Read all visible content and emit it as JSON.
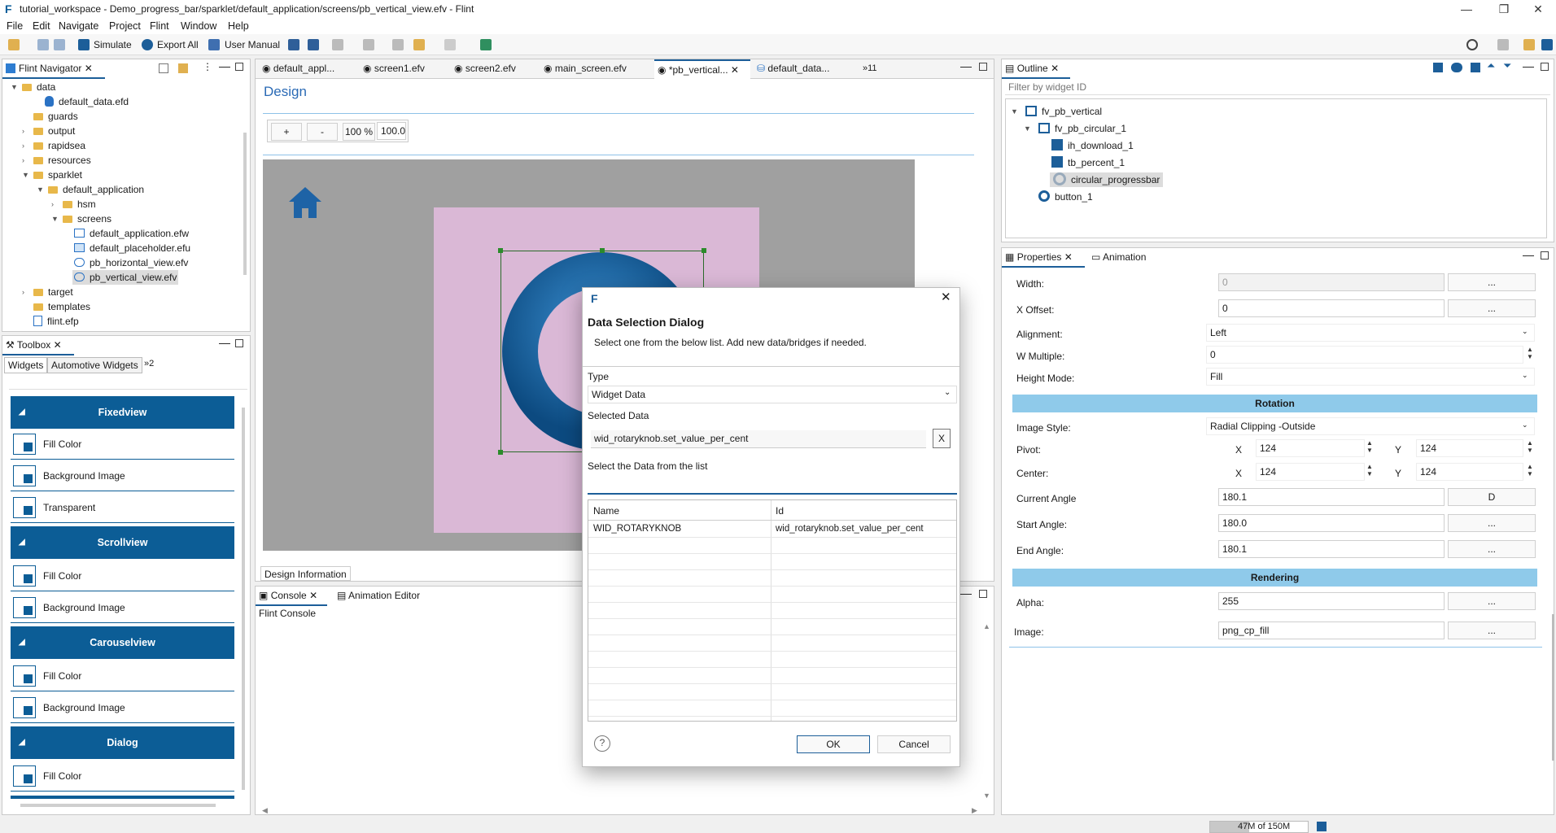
{
  "window": {
    "title": "tutorial_workspace - Demo_progress_bar/sparklet/default_application/screens/pb_vertical_view.efv - Flint",
    "minimize": "—",
    "restore": "❐",
    "close": "✕"
  },
  "menu": [
    "File",
    "Edit",
    "Navigate",
    "Project",
    "Flint",
    "Window",
    "Help"
  ],
  "toolbar": {
    "simulate": "Simulate",
    "export_all": "Export All",
    "user_manual": "User Manual"
  },
  "navigator": {
    "title": "Flint Navigator",
    "items": [
      {
        "label": "data",
        "type": "folder",
        "expanded": true
      },
      {
        "label": "default_data.efd",
        "type": "file"
      },
      {
        "label": "guards",
        "type": "folder"
      },
      {
        "label": "output",
        "type": "folder"
      },
      {
        "label": "rapidsea",
        "type": "folder"
      },
      {
        "label": "resources",
        "type": "folder"
      },
      {
        "label": "sparklet",
        "type": "folder",
        "expanded": true
      },
      {
        "label": "default_application",
        "type": "folder",
        "expanded": true
      },
      {
        "label": "hsm",
        "type": "folder"
      },
      {
        "label": "screens",
        "type": "folder",
        "expanded": true
      },
      {
        "label": "default_application.efw",
        "type": "file"
      },
      {
        "label": "default_placeholder.efu",
        "type": "file"
      },
      {
        "label": "pb_horizontal_view.efv",
        "type": "file"
      },
      {
        "label": "pb_vertical_view.efv",
        "type": "file",
        "selected": true
      },
      {
        "label": "target",
        "type": "folder"
      },
      {
        "label": "templates",
        "type": "folder"
      },
      {
        "label": "flint.efp",
        "type": "file"
      }
    ]
  },
  "toolbox": {
    "title": "Toolbox",
    "tabs": [
      "Widgets",
      "Automotive Widgets",
      "»2"
    ],
    "sections": [
      {
        "head": "Fixedview",
        "items": [
          "Fill Color",
          "Background Image",
          "Transparent"
        ]
      },
      {
        "head": "Scrollview",
        "items": [
          "Fill Color",
          "Background Image"
        ]
      },
      {
        "head": "Carouselview",
        "items": [
          "Fill Color",
          "Background Image"
        ]
      },
      {
        "head": "Dialog",
        "items": [
          "Fill Color"
        ]
      }
    ]
  },
  "editor_tabs": [
    "default_appl...",
    "screen1.efv",
    "screen2.efv",
    "main_screen.efv",
    "*pb_vertical...",
    "default_data...",
    "»11"
  ],
  "design": {
    "title": "Design",
    "zoom_in": "+",
    "zoom_out": "-",
    "zoom_pct": "100 %",
    "zoom_value": "100.0",
    "info_tab": "Design Information"
  },
  "console": {
    "tab": "Console",
    "anim_tab": "Animation Editor",
    "label": "Flint Console"
  },
  "outline": {
    "title": "Outline",
    "filter_placeholder": "Filter by widget ID",
    "items": [
      "fv_pb_vertical",
      "fv_pb_circular_1",
      "ih_download_1",
      "tb_percent_1",
      "circular_progressbar",
      "button_1"
    ]
  },
  "properties": {
    "tab": "Properties",
    "anim_tab": "Animation",
    "width_label": "Width:",
    "width_value": "0",
    "xoffset_label": "X Offset:",
    "xoffset_value": "0",
    "alignment_label": "Alignment:",
    "alignment_value": "Left",
    "wmult_label": "W Multiple:",
    "wmult_value": "0",
    "height_mode_label": "Height Mode:",
    "height_mode_value": "Fill",
    "rotation_section": "Rotation",
    "image_style_label": "Image Style:",
    "image_style_value": "Radial Clipping -Outside",
    "pivot_label": "Pivot:",
    "pivot_x": "124",
    "pivot_y": "124",
    "center_label": "Center:",
    "center_x": "124",
    "center_y": "124",
    "x": "X",
    "y": "Y",
    "current_angle_label": "Current Angle",
    "current_angle_value": "180.1",
    "current_angle_btn": "D",
    "start_angle_label": "Start Angle:",
    "start_angle_value": "180.0",
    "end_angle_label": "End Angle:",
    "end_angle_value": "180.1",
    "rendering_section": "Rendering",
    "alpha_label": "Alpha:",
    "alpha_value": "255",
    "image_label": "Image:",
    "image_value": "png_cp_fill",
    "dots": "..."
  },
  "dialog": {
    "title": "Data Selection Dialog",
    "subtitle": "Select one from the below list. Add new data/bridges if needed.",
    "type_label": "Type",
    "type_value": "Widget Data",
    "selected_label": "Selected Data",
    "selected_value": "wid_rotaryknob.set_value_per_cent",
    "clear": "X",
    "list_label": "Select the Data from the list",
    "col_name": "Name",
    "col_id": "Id",
    "rows": [
      {
        "name": "WID_ROTARYKNOB",
        "id": "wid_rotaryknob.set_value_per_cent"
      }
    ],
    "ok": "OK",
    "cancel": "Cancel",
    "help": "?"
  },
  "status": {
    "memory": "47M of 150M"
  }
}
